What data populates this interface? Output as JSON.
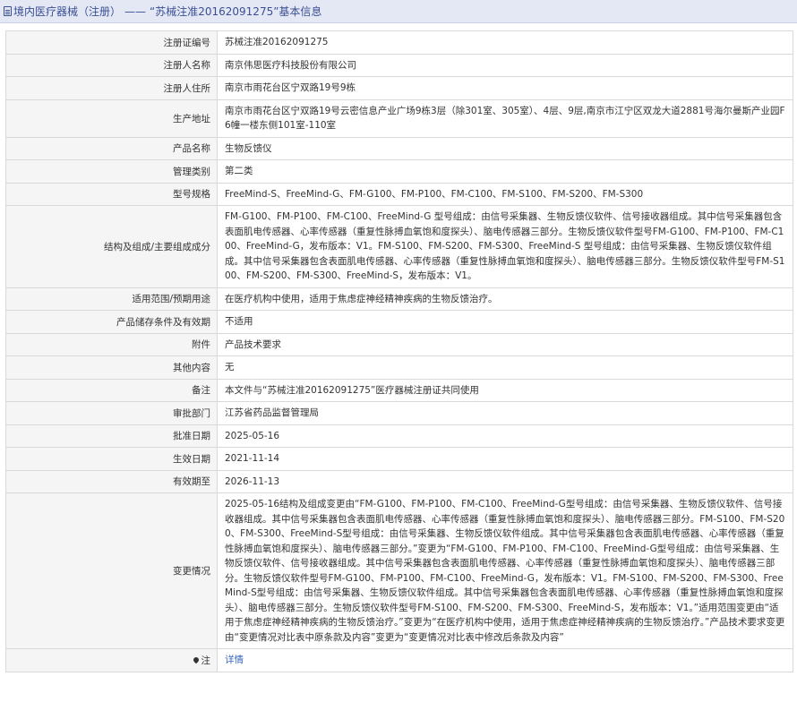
{
  "page_title": {
    "prefix": "境内医疗器械（注册）",
    "separator": "——",
    "record_name": "“苏械注准20162091275”基本信息"
  },
  "rows": [
    {
      "label": "注册证编号",
      "value": "苏械注准20162091275"
    },
    {
      "label": "注册人名称",
      "value": "南京伟思医疗科技股份有限公司"
    },
    {
      "label": "注册人住所",
      "value": "南京市雨花台区宁双路19号9栋"
    },
    {
      "label": "生产地址",
      "value": "南京市雨花台区宁双路19号云密信息产业广场9栋3层（除301室、305室）、4层、9层,南京市江宁区双龙大道2881号海尔曼斯产业园F6幢一楼东侧101室-110室"
    },
    {
      "label": "产品名称",
      "value": "生物反馈仪"
    },
    {
      "label": "管理类别",
      "value": "第二类"
    },
    {
      "label": "型号规格",
      "value": "FreeMind-S、FreeMind-G、FM-G100、FM-P100、FM-C100、FM-S100、FM-S200、FM-S300"
    },
    {
      "label": "结构及组成/主要组成成分",
      "value": "FM-G100、FM-P100、FM-C100、FreeMind-G 型号组成：由信号采集器、生物反馈仪软件、信号接收器组成。其中信号采集器包含表面肌电传感器、心率传感器（重复性脉搏血氧饱和度探头）、脑电传感器三部分。生物反馈仪软件型号FM-G100、FM-P100、FM-C100、FreeMind-G，发布版本：V1。FM-S100、FM-S200、FM-S300、FreeMind-S 型号组成：由信号采集器、生物反馈仪软件组成。其中信号采集器包含表面肌电传感器、心率传感器（重复性脉搏血氧饱和度探头）、脑电传感器三部分。生物反馈仪软件型号FM-S100、FM-S200、FM-S300、FreeMind-S，发布版本：V1。"
    },
    {
      "label": "适用范围/预期用途",
      "value": "在医疗机构中使用，适用于焦虑症神经精神疾病的生物反馈治疗。"
    },
    {
      "label": "产品储存条件及有效期",
      "value": "不适用"
    },
    {
      "label": "附件",
      "value": "产品技术要求"
    },
    {
      "label": "其他内容",
      "value": "无"
    },
    {
      "label": "备注",
      "value": "本文件与“苏械注准20162091275”医疗器械注册证共同使用"
    },
    {
      "label": "审批部门",
      "value": "江苏省药品监督管理局"
    },
    {
      "label": "批准日期",
      "value": "2025-05-16"
    },
    {
      "label": "生效日期",
      "value": "2021-11-14"
    },
    {
      "label": "有效期至",
      "value": "2026-11-13"
    },
    {
      "label": "变更情况",
      "value": "2025-05-16结构及组成变更由“FM-G100、FM-P100、FM-C100、FreeMind-G型号组成：由信号采集器、生物反馈仪软件、信号接收器组成。其中信号采集器包含表面肌电传感器、心率传感器（重复性脉搏血氧饱和度探头）、脑电传感器三部分。FM-S100、FM-S200、FM-S300、FreeMind-S型号组成：由信号采集器、生物反馈仪软件组成。其中信号采集器包含表面肌电传感器、心率传感器（重复性脉搏血氧饱和度探头）、脑电传感器三部分。”变更为“FM-G100、FM-P100、FM-C100、FreeMind-G型号组成：由信号采集器、生物反馈仪软件、信号接收器组成。其中信号采集器包含表面肌电传感器、心率传感器（重复性脉搏血氧饱和度探头）、脑电传感器三部分。生物反馈仪软件型号FM-G100、FM-P100、FM-C100、FreeMind-G，发布版本：V1。FM-S100、FM-S200、FM-S300、FreeMind-S型号组成：由信号采集器、生物反馈仪软件组成。其中信号采集器包含表面肌电传感器、心率传感器（重复性脉搏血氧饱和度探头）、脑电传感器三部分。生物反馈仪软件型号FM-S100、FM-S200、FM-S300、FreeMind-S，发布版本：V1。”适用范围变更由“适用于焦虑症神经精神疾病的生物反馈治疗。”变更为“在医疗机构中使用，适用于焦虑症神经精神疾病的生物反馈治疗。”产品技术要求变更由“变更情况对比表中原条款及内容”变更为“变更情况对比表中修改后条款及内容”"
    }
  ],
  "note_row": {
    "label": "注",
    "link": "详情",
    "icon": "pin-icon"
  },
  "colors": {
    "title_bg": "#e4e8f4",
    "title_text": "#3a4f93",
    "label_bg": "#f5f5f5",
    "border": "#d9d9d9",
    "link": "#3a66c5"
  }
}
